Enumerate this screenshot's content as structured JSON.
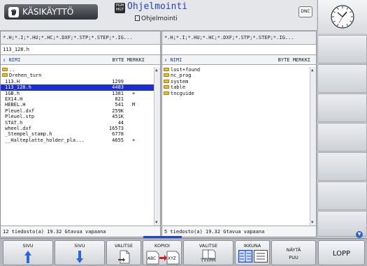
{
  "header": {
    "left_mode": "KÄSIKÄYTTÖ",
    "right_mode_icon": "PGM MGT",
    "right_mode": "Ohjelmointi",
    "right_mode_sub": "Ohjelmointi",
    "dnc": "DNC"
  },
  "left_pane": {
    "filter": "*.H;*.I;*.HU;*.HC;*.DXF;*.STP;*.STEP;*.IG...",
    "path": "113_128.h",
    "col_name": "NIMI",
    "col_size": "BYTE MERKKI",
    "rows": [
      {
        "name": "..",
        "size": "",
        "flag": "",
        "folder": true,
        "selected": false
      },
      {
        "name": "Drehen_turn",
        "size": "",
        "flag": "",
        "folder": true,
        "selected": false
      },
      {
        "name": "113.H",
        "size": "1299",
        "flag": "",
        "folder": false,
        "selected": false
      },
      {
        "name": "113_128.h",
        "size": "4483",
        "flag": "",
        "folder": false,
        "selected": true
      },
      {
        "name": "1GB.h",
        "size": "1381",
        "flag": "+",
        "folder": false,
        "selected": false
      },
      {
        "name": "EX14.H",
        "size": "821",
        "flag": "",
        "folder": false,
        "selected": false
      },
      {
        "name": "HEBEL.H",
        "size": "541",
        "flag": "M",
        "folder": false,
        "selected": false
      },
      {
        "name": "Pleuel.dxf",
        "size": "259K",
        "flag": "",
        "folder": false,
        "selected": false
      },
      {
        "name": "Pleuel.stp",
        "size": "451K",
        "flag": "",
        "folder": false,
        "selected": false
      },
      {
        "name": "STAT.h",
        "size": "44",
        "flag": "",
        "folder": false,
        "selected": false
      },
      {
        "name": "wheel.dxf",
        "size": "16573",
        "flag": "",
        "folder": false,
        "selected": false
      },
      {
        "name": "_Stempel_stamp.h",
        "size": "6778",
        "flag": "",
        "folder": false,
        "selected": false
      },
      {
        "name": "__Halteplatte_holder_pla...",
        "size": "4655",
        "flag": "+",
        "folder": false,
        "selected": false
      }
    ],
    "status": "12  tiedosto(a)  19.32 Gtavua vapaana"
  },
  "right_pane": {
    "filter": "*.H;*.I;*.HU;*.HC;*.DXF;*.STP;*.STEP;*.IG...",
    "col_name": "NIMI",
    "col_size": "BYTE MERKKI",
    "rows": [
      {
        "name": "lost+found",
        "folder": true
      },
      {
        "name": "nc_prog",
        "folder": true
      },
      {
        "name": "system",
        "folder": true
      },
      {
        "name": "table",
        "folder": true
      },
      {
        "name": "tncguide",
        "folder": true
      }
    ],
    "status": "5  tiedosto(a)  19.32 Gtavua vapaana"
  },
  "softkeys": {
    "sivu_up": "SIVU",
    "sivu_down": "SIVU",
    "valitse": "VALITSE",
    "kopioi": "KOPIOI",
    "kopioi_from": "ABC",
    "kopioi_to": "XYZ",
    "valitse_tyyppi_1": "VALITSE",
    "valitse_tyyppi_2": "TYYPPI",
    "ikkuna": "IKKUNA",
    "nayta_puu_1": "NÄYTÄ",
    "nayta_puu_2": "PUU",
    "lopp": "LOPP"
  },
  "colors": {
    "selection": "#1d2fd0",
    "accent": "#1f49c9",
    "folder": "#e6bd30"
  }
}
